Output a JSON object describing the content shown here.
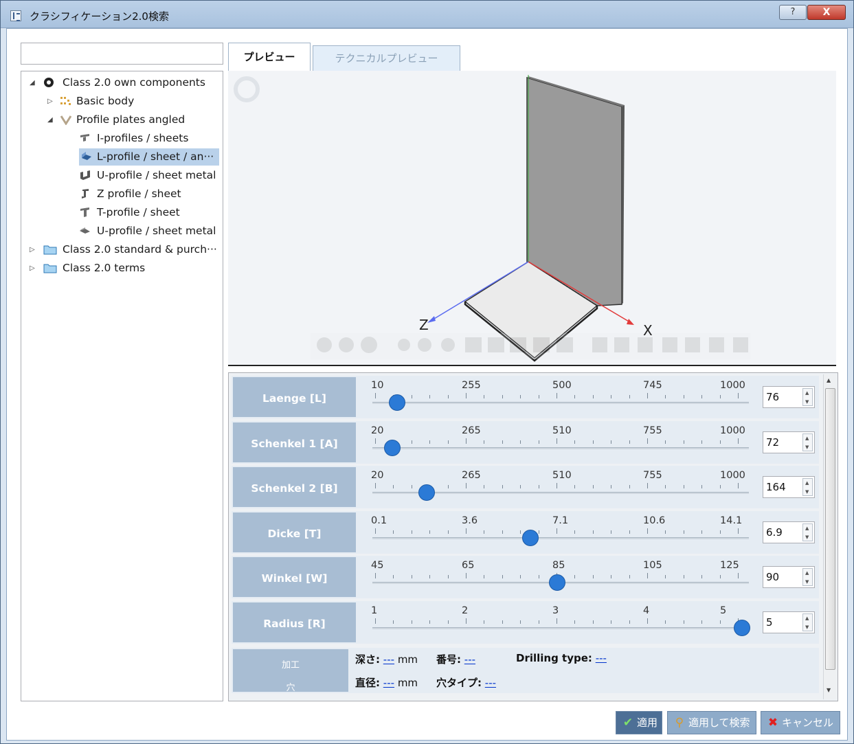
{
  "window": {
    "title": "クラシフィケーション2.0検索",
    "help_label": "?",
    "close_label": "X"
  },
  "search": {
    "value": "",
    "placeholder": ""
  },
  "tree": {
    "items": [
      {
        "label": "Class 2.0 own components",
        "expander": "◢",
        "icon": "class-icon"
      },
      {
        "label": "Basic body",
        "expander": "▷",
        "icon": "basic-body-icon"
      },
      {
        "label": "Profile plates angled",
        "expander": "◢",
        "icon": "profile-plates-icon"
      },
      {
        "label": "I-profiles / sheets",
        "icon": "i-profile-icon"
      },
      {
        "label": "L-profile / sheet / an···",
        "icon": "l-profile-icon",
        "selected": true
      },
      {
        "label": "U-profile / sheet metal",
        "icon": "u-profile-icon"
      },
      {
        "label": "Z profile / sheet",
        "icon": "z-profile-icon"
      },
      {
        "label": "T-profile / sheet",
        "icon": "t-profile-icon"
      },
      {
        "label": "U-profile / sheet metal",
        "icon": "u-profile-icon"
      },
      {
        "label": "Class 2.0 standard & purch···",
        "expander": "▷",
        "icon": "folder-icon"
      },
      {
        "label": "Class 2.0 terms",
        "expander": "▷",
        "icon": "folder-icon"
      }
    ]
  },
  "tabs": {
    "preview": "プレビュー",
    "technical_preview": "テクニカルプレビュー"
  },
  "preview": {
    "axis_z": "Z",
    "axis_x": "X"
  },
  "params": [
    {
      "label": "Laenge [L]",
      "ticks": [
        "10",
        "255",
        "500",
        "745",
        "1000"
      ],
      "value": "76",
      "min": 10,
      "max": 1000,
      "current": 76
    },
    {
      "label": "Schenkel 1 [A]",
      "ticks": [
        "20",
        "265",
        "510",
        "755",
        "1000"
      ],
      "value": "72",
      "min": 20,
      "max": 1000,
      "current": 72
    },
    {
      "label": "Schenkel 2 [B]",
      "ticks": [
        "20",
        "265",
        "510",
        "755",
        "1000"
      ],
      "value": "164",
      "min": 20,
      "max": 1000,
      "current": 164
    },
    {
      "label": "Dicke [T]",
      "ticks": [
        "0.1",
        "3.6",
        "7.1",
        "10.6",
        "14.1"
      ],
      "value": "6.9",
      "min": 0.1,
      "max": 16,
      "current": 6.9
    },
    {
      "label": "Winkel [W]",
      "ticks": [
        "45",
        "65",
        "85",
        "105",
        "125"
      ],
      "value": "90",
      "min": 45,
      "max": 135,
      "current": 90
    },
    {
      "label": "Radius [R]",
      "ticks": [
        "1",
        "2",
        "3",
        "4",
        "5"
      ],
      "value": "5",
      "min": 1,
      "max": 5,
      "current": 5
    }
  ],
  "drilling": {
    "label_top": "加工",
    "label_bottom": "穴",
    "depth_label": "深さ:",
    "depth_value": "---",
    "depth_unit": "mm",
    "number_label": "番号:",
    "number_value": "---",
    "type_label": "Drilling type:",
    "type_value": "---",
    "diameter_label": "直径:",
    "diameter_value": "---",
    "diameter_unit": "mm",
    "hole_type_label": "穴タイプ:",
    "hole_type_value": "---"
  },
  "buttons": {
    "apply": "適用",
    "apply_search": "適用して検索",
    "cancel": "キャンセル"
  }
}
